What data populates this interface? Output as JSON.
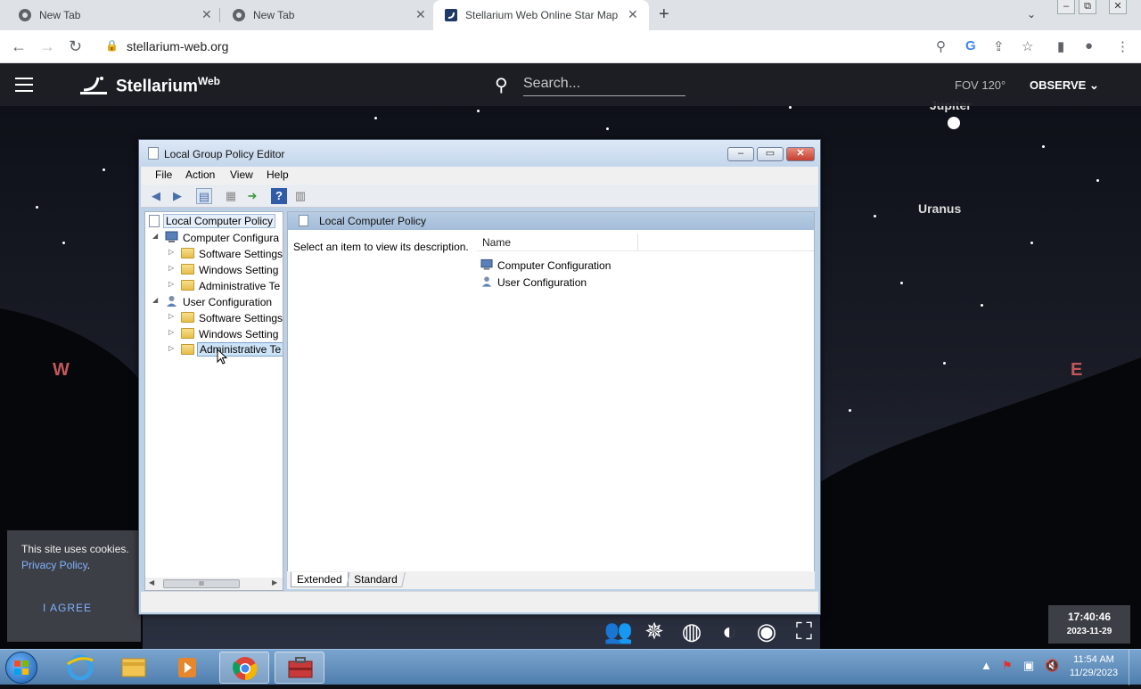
{
  "browser": {
    "tabs": [
      {
        "title": "New Tab",
        "active": false
      },
      {
        "title": "New Tab",
        "active": false
      },
      {
        "title": "Stellarium Web Online Star Map",
        "active": true
      }
    ],
    "new_tab_symbol": "+",
    "address": "stellarium-web.org"
  },
  "stellarium": {
    "app_name": "Stellarium",
    "app_name_sup": "Web",
    "search_placeholder": "Search...",
    "fov": "FOV 120°",
    "observe_label": "OBSERVE",
    "labels": {
      "jupiter": "Jupiter",
      "uranus": "Uranus"
    },
    "cardinals": {
      "west": "W",
      "east": "E"
    },
    "cookie": {
      "text": "This site uses cookies.",
      "link": "Privacy Policy",
      "link_tail": ".",
      "agree": "I AGREE"
    },
    "time": "17:40:46",
    "date": "2023-11-29"
  },
  "gpe": {
    "title": "Local Group Policy Editor",
    "menu": [
      "File",
      "Action",
      "View",
      "Help"
    ],
    "tree": {
      "root": "Local Computer Policy",
      "computer": "Computer Configura",
      "computer_children": [
        "Software Settings",
        "Windows Setting",
        "Administrative Te"
      ],
      "user": "User Configuration",
      "user_children": [
        "Software Settings",
        "Windows Setting",
        "Administrative Te"
      ]
    },
    "right_header": "Local Computer Policy",
    "description": "Select an item to view its description.",
    "name_column": "Name",
    "items": [
      "Computer Configuration",
      "User Configuration"
    ],
    "bottom_tabs": [
      "Extended",
      "Standard"
    ],
    "scroll_thumb": "III"
  },
  "taskbar": {
    "time": "11:54 AM",
    "date": "11/29/2023"
  }
}
